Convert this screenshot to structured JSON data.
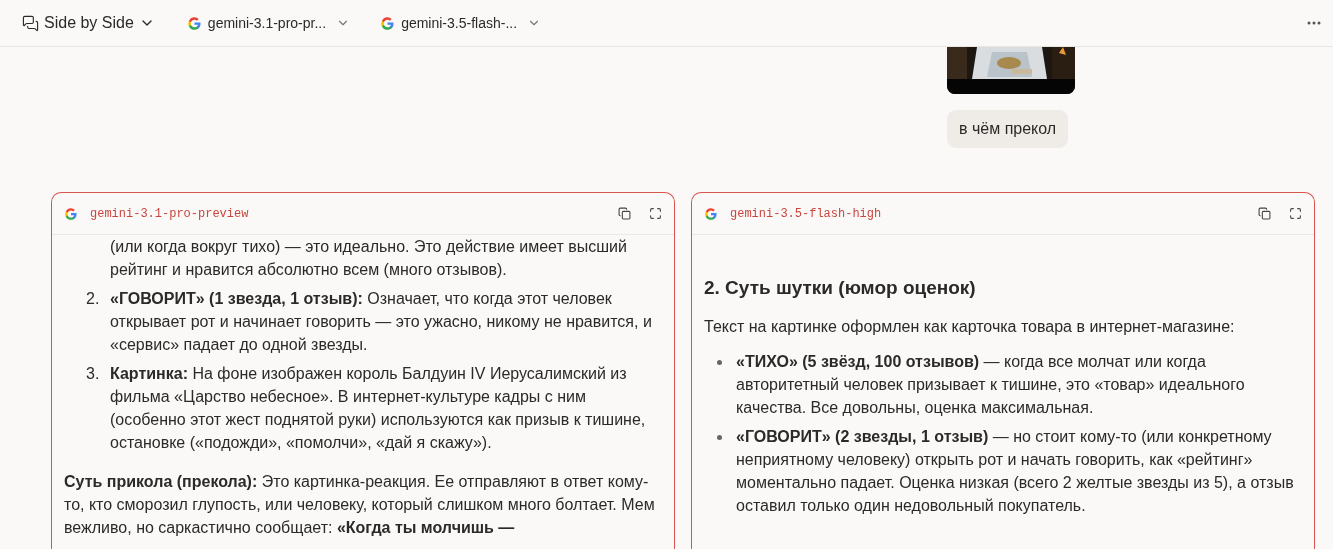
{
  "header": {
    "mode": "Side by Side",
    "models": [
      {
        "name": "gemini-3.1-pro-pr..."
      },
      {
        "name": "gemini-3.5-flash-..."
      }
    ]
  },
  "conversation": {
    "message": "в чём прекол"
  },
  "panels": [
    {
      "model": "gemini-3.1-pro-preview",
      "blocks": [
        {
          "kind": "continuation",
          "text": "(или когда вокруг тихо) — это идеально. Это действие имеет высший рейтинг и нравится абсолютно всем (много отзывов)."
        },
        {
          "kind": "numbered",
          "marker": "2.",
          "text": "**«ГОВОРИТ» (1 звезда, 1 отзыв):** Означает, что когда этот человек открывает рот и начинает говорить — это ужасно, никому не нравится, и «сервис» падает до одной звезды."
        },
        {
          "kind": "numbered",
          "marker": "3.",
          "text": "**Картинка:** На фоне изображен король Балдуин IV Иерусалимский из фильма «Царство небесное». В интернет-культуре кадры с ним (особенно этот жест поднятой руки) используются как призыв к тишине, остановке («подожди», «помолчи», «дай я скажу»)."
        },
        {
          "kind": "paragraph",
          "text": "**Суть прикола (прекола):** Это картинка-реакция. Ее отправляют в ответ кому-то, кто сморозил глупость, или человеку, который слишком много болтает. Мем вежливо, но саркастично сообщает: **«Когда ты молчишь —**"
        }
      ]
    },
    {
      "model": "gemini-3.5-flash-high",
      "blocks": [
        {
          "kind": "heading",
          "text": "2. Суть шутки (юмор оценок)"
        },
        {
          "kind": "paragraph",
          "text": "Текст на картинке оформлен как карточка товара в интернет-магазине:"
        },
        {
          "kind": "bullet",
          "text": "**«ТИХО» (5 звёзд, 100 отзывов)** — когда все молчат или когда авторитетный человек призывает к тишине, это «товар» идеального качества. Все довольны, оценка максимальная."
        },
        {
          "kind": "bullet",
          "text": "**«ГОВОРИТ» (2 звезды, 1 отзыв)** — но стоит кому-то (или конкретному неприятному человеку) открыть рот и начать говорить, как «рейтинг» моментально падает. Оценка низкая (всего 2 желтые звезды из 5), а отзыв оставил только один недовольный покупатель."
        }
      ]
    }
  ]
}
